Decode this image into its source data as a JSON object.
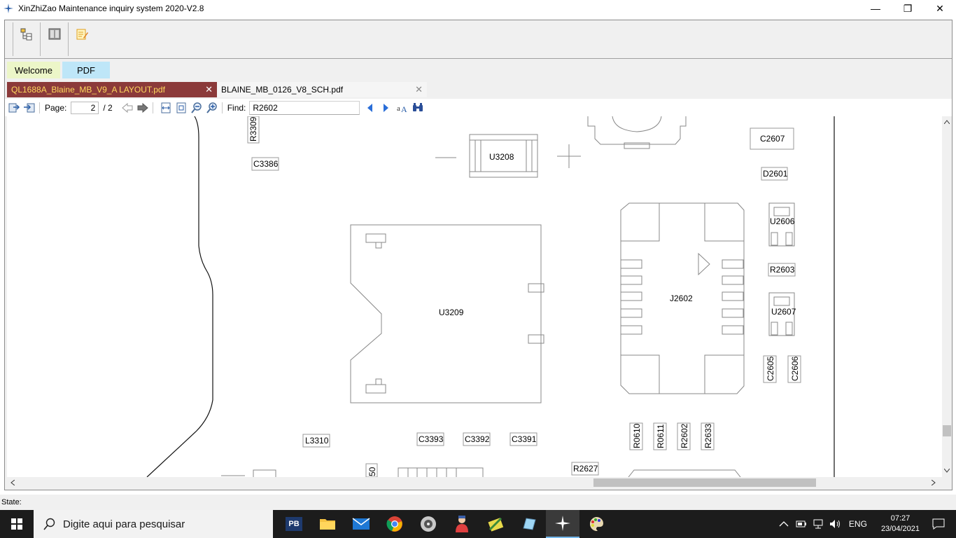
{
  "window": {
    "title": "XinZhiZao Maintenance inquiry system 2020-V2.8",
    "minimize": "—",
    "maximize": "❐",
    "close": "✕"
  },
  "toolbar": {
    "buttons": [
      {
        "name": "tree-view-button",
        "icon": "tree-icon"
      },
      {
        "name": "panel-button",
        "icon": "panel-icon"
      },
      {
        "name": "notes-button",
        "icon": "notes-icon"
      }
    ]
  },
  "main_tabs": [
    {
      "label": "Welcome"
    },
    {
      "label": "PDF"
    }
  ],
  "doc_tabs": [
    {
      "label": "QL1688A_Blaine_MB_V9_A LAYOUT.pdf",
      "close": "✕",
      "active": true
    },
    {
      "label": "BLAINE_MB_0126_V8_SCH.pdf",
      "close": "✕",
      "active": false
    }
  ],
  "pdf_toolbar": {
    "page_label": "Page:",
    "page_value": "2",
    "page_total": "/ 2",
    "find_label": "Find:",
    "find_value": "R2602"
  },
  "layout_labels": {
    "r3309": "R3309",
    "c3386": "C3386",
    "u3208": "U3208",
    "c2607": "C2607",
    "d2601": "D2601",
    "u2606": "U2606",
    "r2603": "R2603",
    "u2607": "U2607",
    "u3209": "U3209",
    "j2602": "J2602",
    "c2605": "C2605",
    "c2606": "C2606",
    "l3310": "L3310",
    "c3393": "C3393",
    "c3392": "C3392",
    "c3391": "C3391",
    "r0610": "R0610",
    "r0611": "R0611",
    "r2602": "R2602",
    "r2633": "R2633",
    "r2627": "R2627",
    "x50": "50"
  },
  "statusbar": {
    "label": "State:"
  },
  "taskbar": {
    "search_placeholder": "Digite aqui para pesquisar",
    "apps": [
      "PB",
      "file-explorer",
      "mail",
      "chrome",
      "media",
      "user-app",
      "tool-app",
      "notebook-app",
      "xinzhizao-app",
      "paint-app"
    ],
    "lang": "ENG",
    "time": "07:27",
    "date": "23/04/2021"
  }
}
